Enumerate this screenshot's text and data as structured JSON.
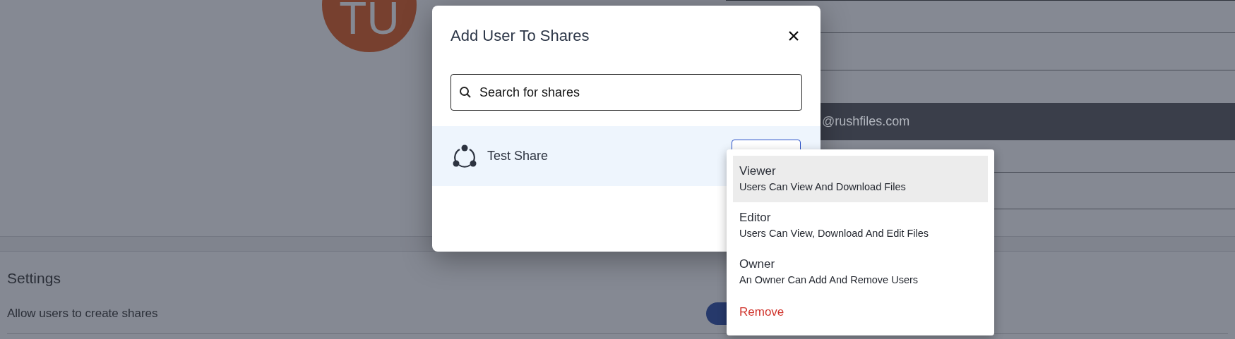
{
  "page": {
    "avatar": {
      "initials": "TU"
    },
    "email_field": {
      "value": "@rushfiles.com"
    },
    "settings": {
      "title": "Settings",
      "options": [
        {
          "label": "Allow users to create shares",
          "on": true
        }
      ]
    }
  },
  "dialog": {
    "title": "Add User To Shares",
    "search": {
      "placeholder": "Search for shares"
    },
    "shares": [
      {
        "name": "Test Share",
        "selected": true
      }
    ]
  },
  "role_menu": {
    "items": [
      {
        "kind": "role",
        "title": "Viewer",
        "description": "Users Can View And Download Files",
        "selected": true
      },
      {
        "kind": "role",
        "title": "Editor",
        "description": "Users Can View, Download And Edit Files",
        "selected": false
      },
      {
        "kind": "role",
        "title": "Owner",
        "description": "An Owner Can Add And Remove Users",
        "selected": false
      },
      {
        "kind": "danger",
        "title": "Remove"
      }
    ]
  }
}
